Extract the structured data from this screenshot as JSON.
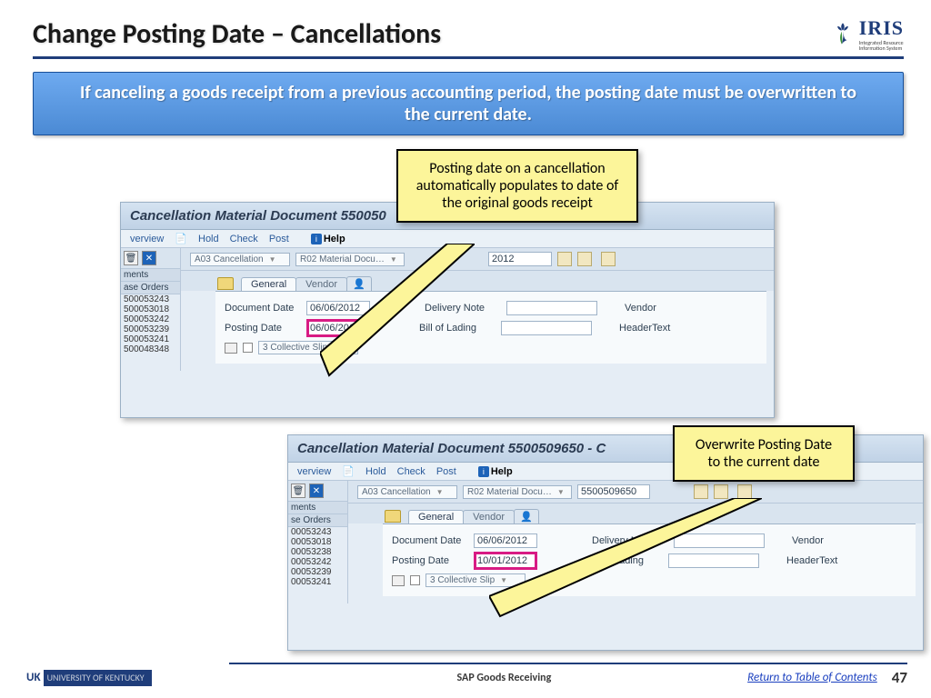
{
  "title": "Change Posting Date – Cancellations",
  "logo": {
    "name": "IRIS",
    "sub1": "Integrated Resource",
    "sub2": "Information System"
  },
  "banner": "If canceling a goods receipt from a previous accounting period, the posting date must be overwritten to the current date.",
  "callout1": "Posting date on a cancellation automatically populates to date of the original goods receipt",
  "callout2": "Overwrite Posting Date to the current date",
  "sap1": {
    "title": "Cancellation Material Document 550050",
    "toolbar": {
      "overview": "verview",
      "hold": "Hold",
      "check": "Check",
      "post": "Post",
      "help": "Help"
    },
    "filter": {
      "type": "A03 Cancellation",
      "doc": "R02 Material Docu…",
      "year": "2012"
    },
    "side": {
      "hdr1": "ments",
      "hdr2": "ase Orders",
      "items": [
        "500053243",
        "500053018",
        "500053242",
        "500053239",
        "500053241",
        "500048348"
      ]
    },
    "tabs": {
      "general": "General",
      "vendor": "Vendor"
    },
    "form": {
      "docdate_lbl": "Document Date",
      "docdate": "06/06/2012",
      "postdate_lbl": "Posting Date",
      "postdate": "06/06/2012",
      "slip": "3 Collective Slip",
      "delivnote_lbl": "Delivery Note",
      "bol_lbl": "Bill of Lading",
      "vendor_lbl": "Vendor",
      "headertext_lbl": "HeaderText"
    }
  },
  "sap2": {
    "title": "Cancellation Material Document 5500509650 - C",
    "toolbar": {
      "overview": "verview",
      "hold": "Hold",
      "check": "Check",
      "post": "Post",
      "help": "Help"
    },
    "filter": {
      "type": "A03 Cancellation",
      "doc": "R02 Material Docu…",
      "num": "5500509650"
    },
    "side": {
      "hdr1": "ments",
      "hdr2": "se Orders",
      "items": [
        "00053243",
        "00053018",
        "00053238",
        "00053242",
        "00053239",
        "00053241"
      ]
    },
    "tabs": {
      "general": "General",
      "vendor": "Vendor"
    },
    "form": {
      "docdate_lbl": "Document Date",
      "docdate": "06/06/2012",
      "postdate_lbl": "Posting Date",
      "postdate": "10/01/2012",
      "slip": "3 Collective Slip",
      "delivnote_lbl": "Delivery Note",
      "bol_lbl": "Bill of Lading",
      "vendor_lbl": "Vendor",
      "headertext_lbl": "HeaderText"
    }
  },
  "footer": {
    "uk": "UNIVERSITY OF KENTUCKY",
    "center": "SAP Goods Receiving",
    "toc": "Return to Table of Contents",
    "page": "47"
  }
}
